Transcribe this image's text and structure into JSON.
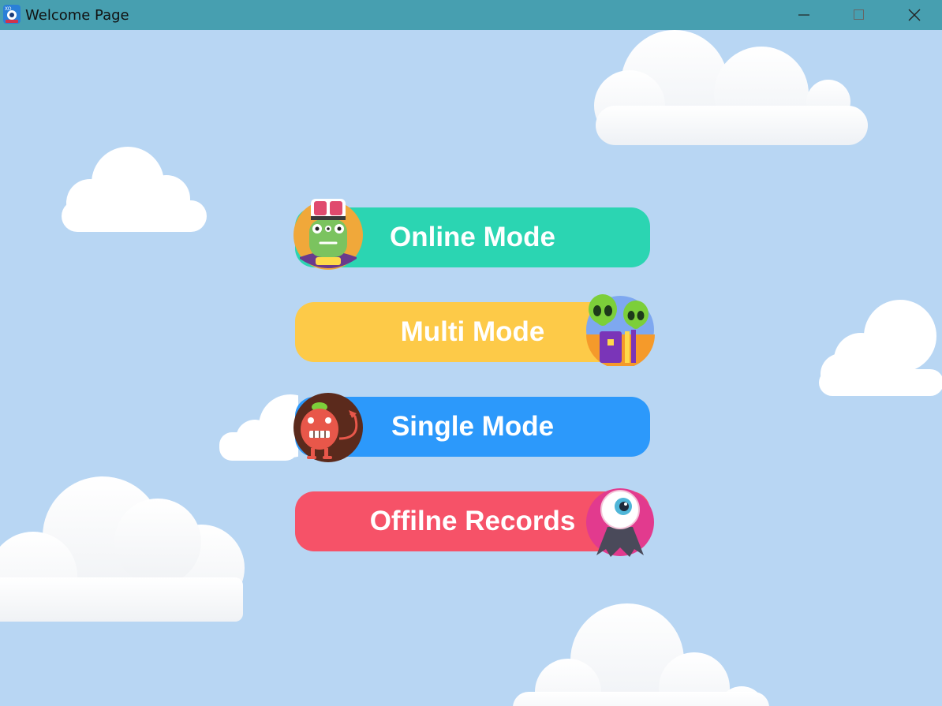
{
  "window": {
    "title": "Welcome Page",
    "controls": [
      "minimize",
      "maximize",
      "close"
    ]
  },
  "menu": {
    "items": [
      {
        "label": "Online Mode",
        "color": "#2bd5b2",
        "icon": "zombie-avatar-icon"
      },
      {
        "label": "Multi Mode",
        "color": "#fdca48",
        "icon": "aliens-avatar-icon"
      },
      {
        "label": "Single Mode",
        "color": "#2c99fb",
        "icon": "robot-avatar-icon"
      },
      {
        "label": "Offilne Records",
        "color": "#f65268",
        "icon": "eyeball-monster-avatar-icon"
      }
    ]
  },
  "theme": {
    "background": "#b8d6f3",
    "titlebar": "#479fb0"
  }
}
